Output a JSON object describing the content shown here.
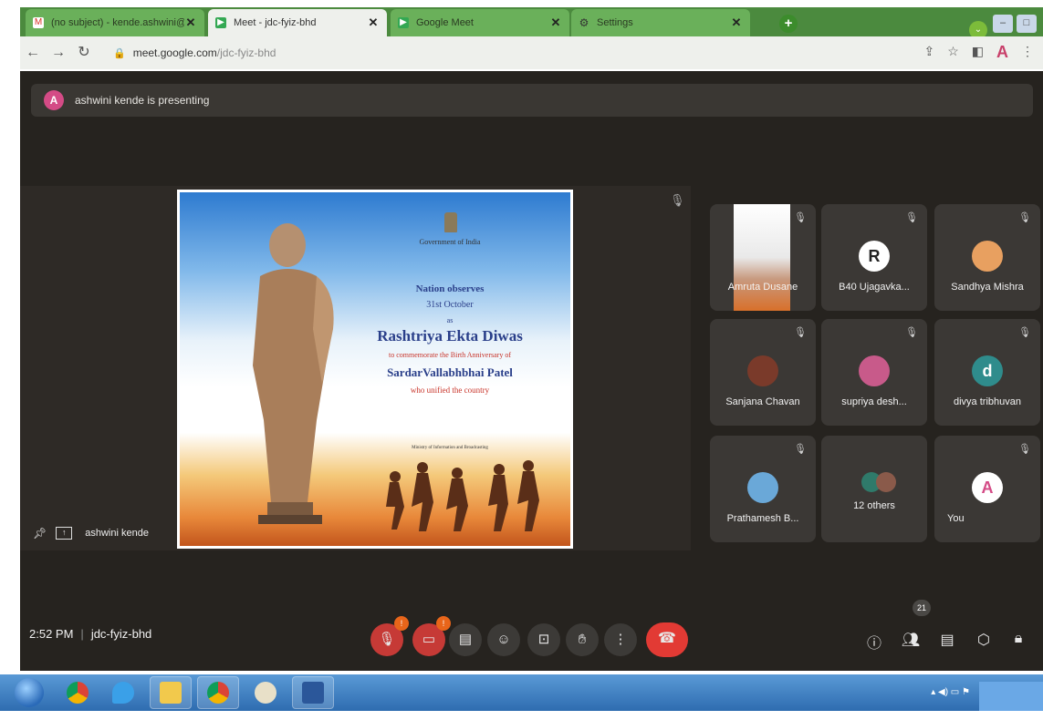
{
  "browser": {
    "tabs": [
      {
        "title": "(no subject) - kende.ashwini@gr",
        "favicon": "gmail-icon",
        "active": false
      },
      {
        "title": "Meet - jdc-fyiz-bhd",
        "favicon": "meet-icon",
        "active": true
      },
      {
        "title": "Google Meet",
        "favicon": "meet-icon",
        "active": false
      },
      {
        "title": "Settings",
        "favicon": "gear-icon",
        "active": false
      }
    ],
    "close_glyph": "✕",
    "new_tab_glyph": "+",
    "address": {
      "host": "meet.google.com",
      "path": "/jdc-fyiz-bhd"
    },
    "profile_initial": "A"
  },
  "meet": {
    "presenting_banner": "ashwini kende is presenting",
    "presenter_initial": "A",
    "stage_label": "ashwini kende",
    "slide": {
      "org": "Government of India",
      "line1": "Nation observes",
      "line2": "31st October",
      "line3": "as",
      "title": "Rashtriya Ekta Diwas",
      "line4": "to commemorate the Birth Anniversary of",
      "name": "SardarVallabhbhai Patel",
      "line5": "who unified the country",
      "footer": "Ministry of Information and Broadcasting"
    },
    "tiles": [
      {
        "name": "Amruta Dusane",
        "type": "video"
      },
      {
        "name": "B40 Ujagavka...",
        "type": "initial",
        "initial": "R",
        "color": "#ffffff"
      },
      {
        "name": "Sandhya Mishra",
        "type": "photo",
        "color": "#e8a060"
      },
      {
        "name": "Sanjana Chavan",
        "type": "photo",
        "color": "#7a3a2a"
      },
      {
        "name": "supriya desh...",
        "type": "photo",
        "color": "#c85a8a"
      },
      {
        "name": "divya tribhuvan",
        "type": "initial",
        "initial": "d",
        "color": "#2f8c8c"
      },
      {
        "name": "Prathamesh B...",
        "type": "photo",
        "color": "#6aa8d8"
      },
      {
        "name": "12 others",
        "type": "group"
      },
      {
        "name": "You",
        "type": "initial",
        "initial": "A",
        "color": "#ffffff"
      }
    ],
    "bottom": {
      "time": "2:52 PM",
      "meeting_code": "jdc-fyiz-bhd",
      "mic_badge": "!",
      "cam_badge": "!",
      "participant_count": "21"
    }
  },
  "colors": {
    "meet_bg": "#26231f",
    "end_call": "#e23a34",
    "tab_strip": "#4b8a3e"
  }
}
